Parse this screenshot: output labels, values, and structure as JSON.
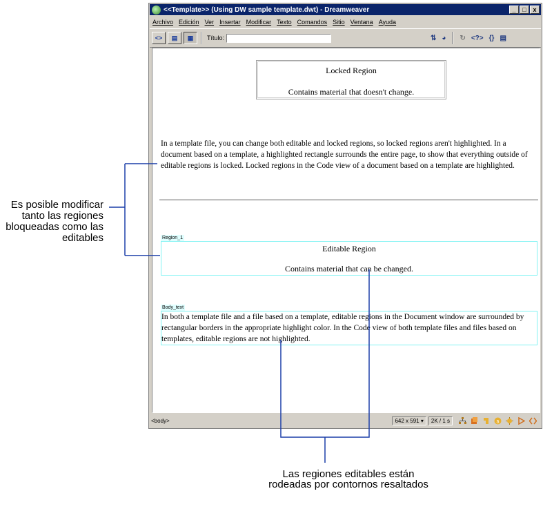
{
  "window": {
    "title": "<<Template>> (Using DW sample template.dwt) - Dreamweaver",
    "controls": {
      "minimize": "_",
      "maximize": "□",
      "close": "x"
    }
  },
  "menu": [
    "Archivo",
    "Edición",
    "Ver",
    "Insertar",
    "Modificar",
    "Texto",
    "Comandos",
    "Sitio",
    "Ventana",
    "Ayuda"
  ],
  "toolbar": {
    "title_label": "Título:",
    "title_value": "",
    "view_buttons": [
      "code-view-icon",
      "split-view-icon",
      "design-view-icon"
    ],
    "tools": [
      {
        "icon": "file-management-icon",
        "glyph": "⇅",
        "grey": false
      },
      {
        "icon": "preview-browser-icon",
        "glyph": "◕",
        "grey": false
      },
      {
        "icon": "refresh-icon",
        "glyph": "↻",
        "grey": true
      },
      {
        "icon": "reference-icon",
        "glyph": "<?>",
        "grey": false
      },
      {
        "icon": "code-navigation-icon",
        "glyph": "{}",
        "grey": false
      },
      {
        "icon": "view-options-icon",
        "glyph": "▤",
        "grey": false
      }
    ]
  },
  "document": {
    "locked_title": "Locked Region",
    "locked_desc": "Contains material that doesn't change.",
    "intro": "In a template file, you can change both editable and locked regions, so locked regions aren't highlighted. In a document based on a template, a highlighted rectangle surrounds the entire page, to show that everything outside of editable regions is locked. Locked regions in the Code view of a document based on a template are highlighted.",
    "region1_tab": "Region_1",
    "editable_title": "Editable Region",
    "editable_desc": "Contains material that can be changed.",
    "region2_tab": "Body_text",
    "body_text": "In both a template file and a file based on a template, editable regions in the Document window are surrounded by rectangular borders in the appropriate highlight color. In the Code view of both template files and files based on templates, editable regions are not highlighted."
  },
  "status": {
    "tag": "<body>",
    "window_size": "642 x 591",
    "download": "2K / 1 s",
    "launcher_icons": [
      "site-icon",
      "assets-icon",
      "html-styles-icon",
      "css-styles-icon",
      "behaviors-icon",
      "timeline-icon",
      "code-inspector-icon"
    ]
  },
  "callouts": {
    "left": "Es posible modificar tanto las regiones bloqueadas como las editables",
    "bottom": "Las regiones editables están rodeadas por contornos resaltados"
  },
  "colors": {
    "titlebar": "#0a246a",
    "highlight": "#7ff3f3",
    "region_tab": "#dffefe"
  }
}
